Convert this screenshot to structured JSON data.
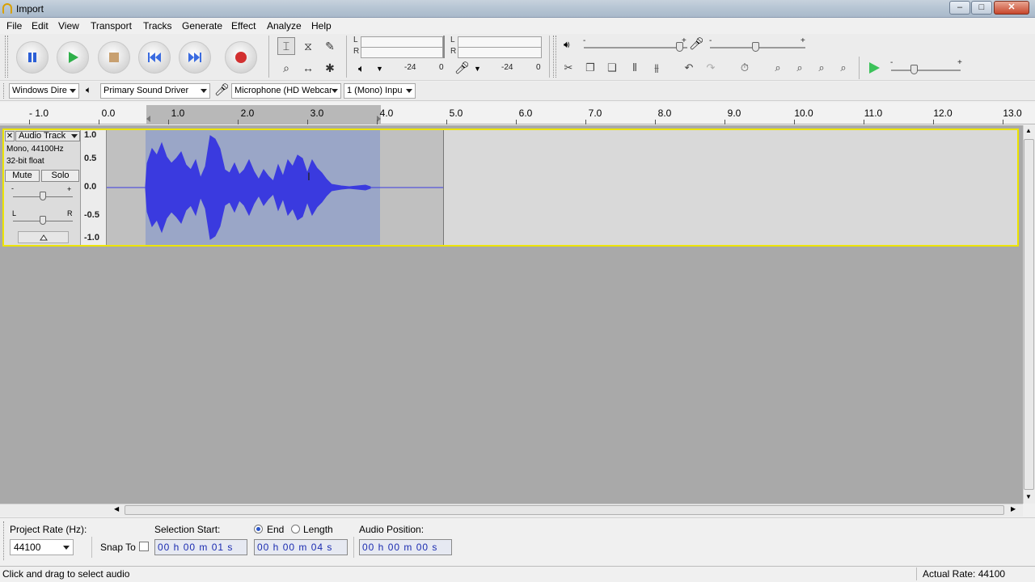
{
  "window": {
    "title": "Import",
    "min_glyph": "–",
    "max_glyph": "□",
    "close_glyph": "✕"
  },
  "menu": [
    "File",
    "Edit",
    "View",
    "Transport",
    "Tracks",
    "Generate",
    "Effect",
    "Analyze",
    "Help"
  ],
  "meters": {
    "play_L": "L",
    "play_R": "R",
    "rec_L": "L",
    "rec_R": "R",
    "tick_neg24": "-24",
    "tick_0": "0"
  },
  "mixer": {
    "minus": "-",
    "plus": "+"
  },
  "devices": {
    "host": "Windows Dire",
    "playback": "Primary Sound Driver",
    "recording": "Microphone (HD Webcar",
    "channels": "1 (Mono) Inpu"
  },
  "ruler": {
    "labels": [
      "- 1.0",
      "0.0",
      "1.0",
      "2.0",
      "3.0",
      "4.0",
      "5.0",
      "6.0",
      "7.0",
      "8.0",
      "9.0",
      "10.0",
      "11.0",
      "12.0",
      "13.0"
    ]
  },
  "track": {
    "name": "Audio Track",
    "info_line1": "Mono, 44100Hz",
    "info_line2": "32-bit float",
    "mute": "Mute",
    "solo": "Solo",
    "gain_minus": "-",
    "gain_plus": "+",
    "pan_left": "L",
    "pan_right": "R",
    "scale": [
      "1.0",
      "0.5",
      "0.0",
      "-0.5",
      "-1.0"
    ],
    "wave_color": "#3a3adf",
    "selection_color": "#8d9eca"
  },
  "selection": {
    "project_rate_label": "Project Rate (Hz):",
    "project_rate": "44100",
    "snap_to": "Snap To",
    "start_label": "Selection Start:",
    "end_label": "End",
    "length_label": "Length",
    "audio_position_label": "Audio Position:",
    "start_value": "00 h 00 m 01 s",
    "end_value": "00 h 00 m 04 s",
    "position_value": "00 h 00 m 00 s"
  },
  "status": {
    "left": "Click and drag to select audio",
    "right": "Actual Rate: 44100"
  }
}
